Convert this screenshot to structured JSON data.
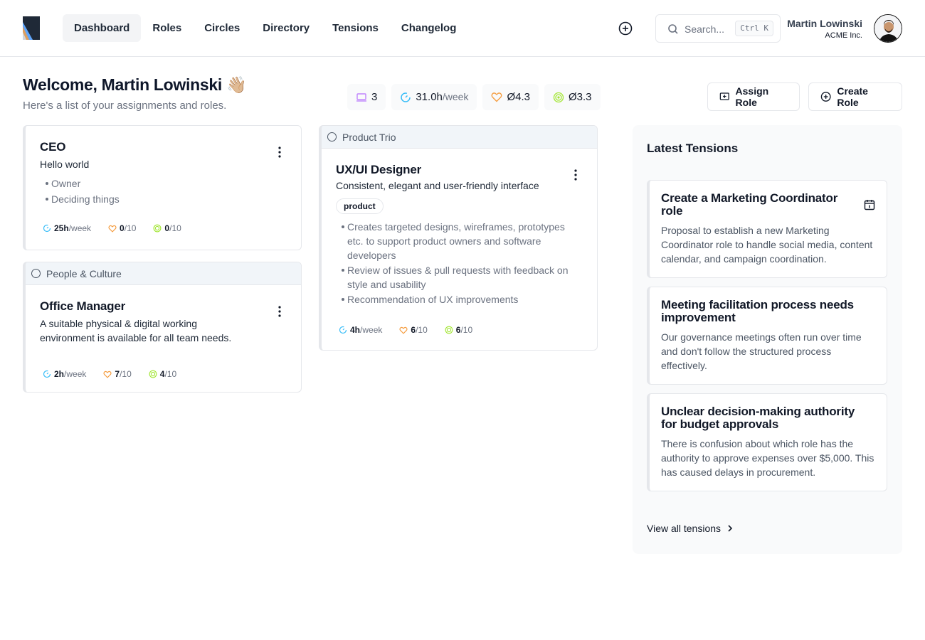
{
  "nav": {
    "items": [
      {
        "label": "Dashboard",
        "active": true
      },
      {
        "label": "Roles"
      },
      {
        "label": "Circles"
      },
      {
        "label": "Directory"
      },
      {
        "label": "Tensions"
      },
      {
        "label": "Changelog"
      }
    ]
  },
  "search": {
    "placeholder": "Search...",
    "shortcut": "Ctrl K"
  },
  "user": {
    "name": "Martin Lowinski",
    "org": "ACME Inc."
  },
  "welcome": {
    "title": "Welcome, Martin Lowinski 👋🏼",
    "subtitle": "Here's a list of your assignments and roles."
  },
  "stats": {
    "roles": "3",
    "hours": "31.0h",
    "hours_unit": "/week",
    "heart": "Ø4.3",
    "energy": "Ø3.3"
  },
  "actions": {
    "assign_role": "Assign Role",
    "create_role": "Create Role"
  },
  "roles": [
    {
      "title": "CEO",
      "purpose": "Hello world",
      "responsibilities": [
        "Owner",
        "Deciding things"
      ],
      "hours": "25h",
      "hours_unit": "/week",
      "heart": "0",
      "heart_max": "/10",
      "energy": "0",
      "energy_max": "/10"
    },
    {
      "circle": "People & Culture",
      "title": "Office Manager",
      "purpose": "A suitable physical & digital working environment is available for all team needs.",
      "hours": "2h",
      "hours_unit": "/week",
      "heart": "7",
      "heart_max": "/10",
      "energy": "4",
      "energy_max": "/10"
    },
    {
      "circle": "Product Trio",
      "title": "UX/UI Designer",
      "purpose": "Consistent, elegant and user-friendly interface",
      "tag": "product",
      "responsibilities": [
        "Creates targeted designs, wireframes, prototypes etc. to support product owners and software developers",
        "Review of issues & pull requests with feedback on style and usability",
        "Recommendation of UX improvements"
      ],
      "hours": "4h",
      "hours_unit": "/week",
      "heart": "6",
      "heart_max": "/10",
      "energy": "6",
      "energy_max": "/10"
    }
  ],
  "tensions": {
    "title": "Latest Tensions",
    "items": [
      {
        "title": "Create a Marketing Coordinator role",
        "description": "Proposal to establish a new Marketing Coordinator role to handle social media, content calendar, and campaign coordination."
      },
      {
        "title": "Meeting facilitation process needs improvement",
        "description": "Our governance meetings often run over time and don't follow the structured process effectively."
      },
      {
        "title": "Unclear decision-making authority for budget approvals",
        "description": "There is confusion about which role has the authority to approve expenses over $5,000. This has caused delays in procurement."
      }
    ],
    "view_all": "View all tensions"
  },
  "colors": {
    "heart": "#f59e42",
    "energy": "#a3e635",
    "time": "#38bdf8",
    "roles": "#c084fc"
  }
}
